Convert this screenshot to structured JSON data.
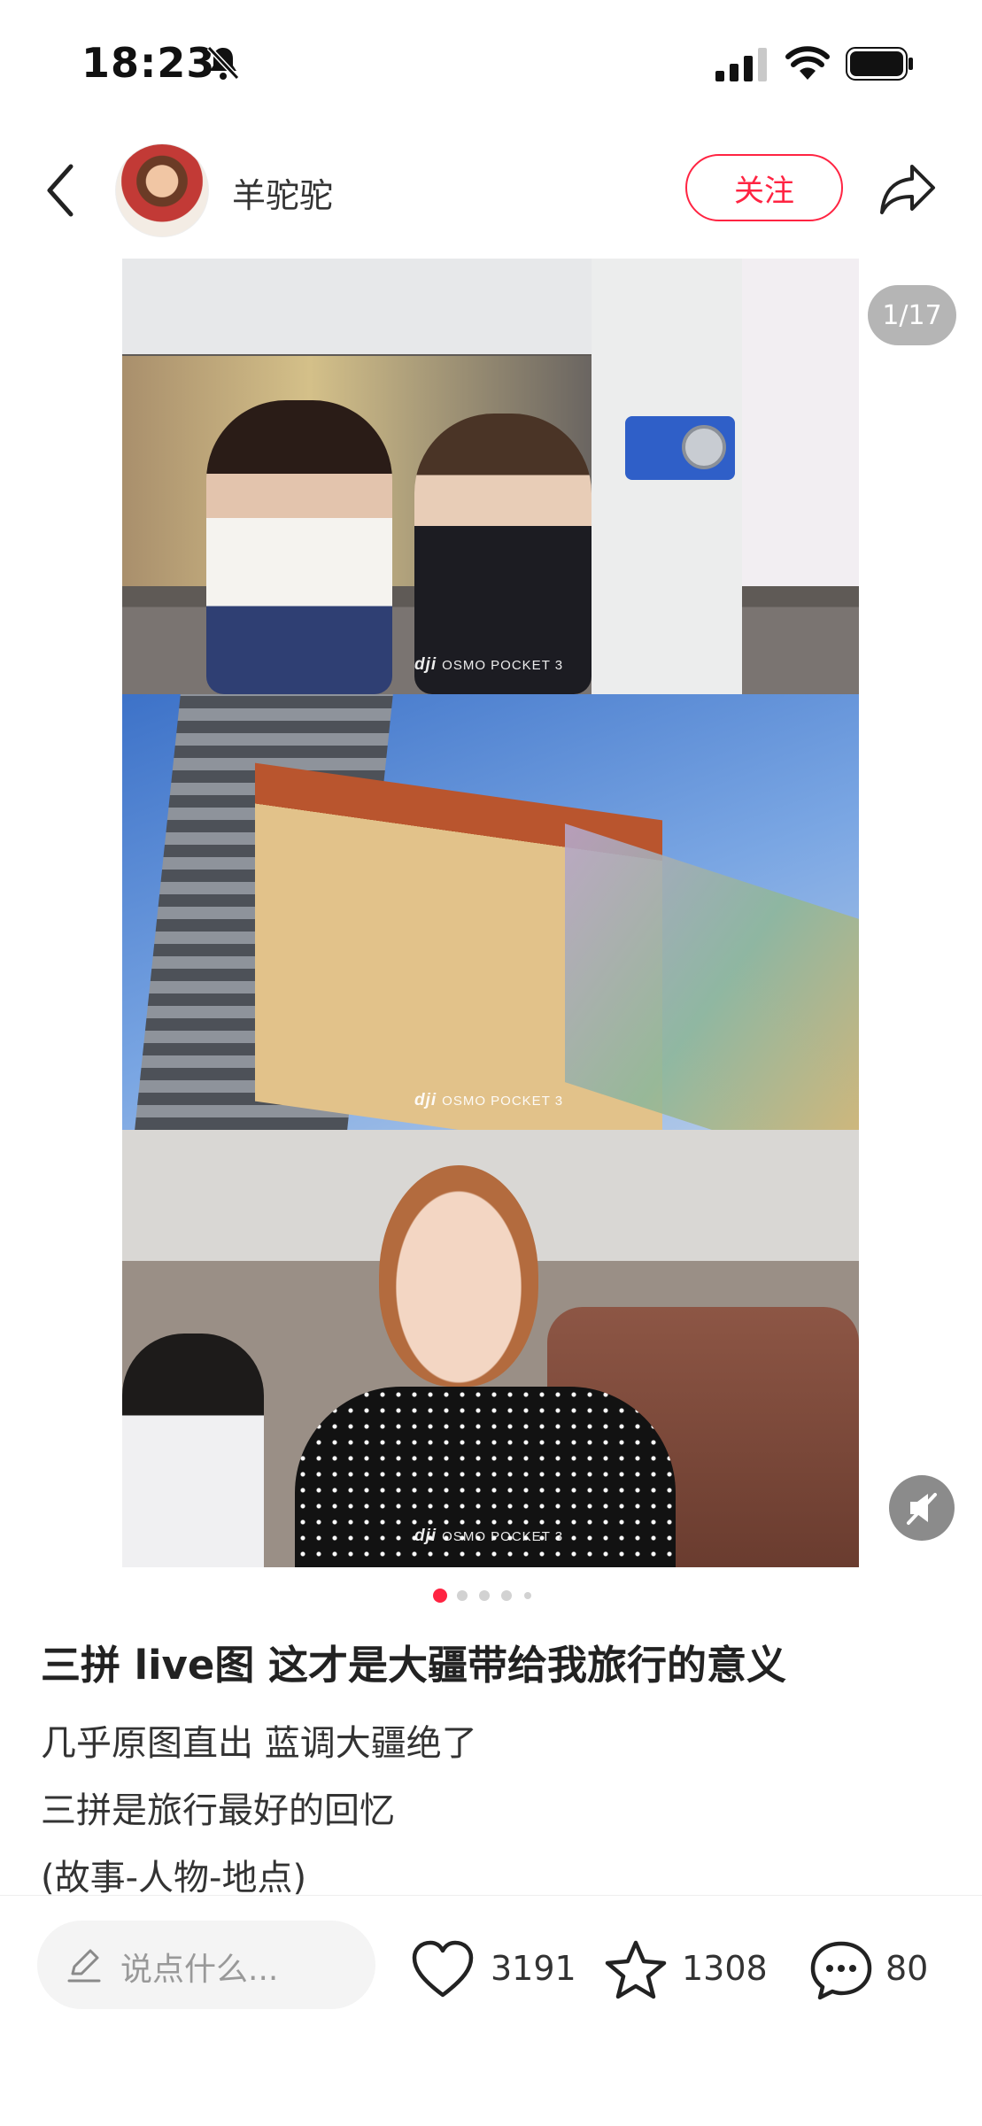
{
  "status_bar": {
    "time": "18:23",
    "icons": [
      "bell-slash-icon",
      "signal-icon",
      "wifi-icon",
      "battery-icon"
    ]
  },
  "header": {
    "back_icon": "chevron-left-icon",
    "author_name": "羊驼驼",
    "follow_label": "关注",
    "share_icon": "share-arrow-icon",
    "accent_color": "#ff2442"
  },
  "media": {
    "page_counter": "1/17",
    "watermark_brand": "dji",
    "watermark_product": "OSMO POCKET 3",
    "mute_icon": "speaker-mute-icon",
    "current_page": 1,
    "visible_dot_count": 5
  },
  "note": {
    "title": "三拼 live图 这才是大疆带给我旅行的意义",
    "lines": [
      "几乎原图直出 蓝调大疆绝了",
      "三拼是旅行最好的回忆",
      "(故事-人物-地点)"
    ]
  },
  "bottom_bar": {
    "comment_placeholder": "说点什么...",
    "likes": "3191",
    "collects": "1308",
    "comments": "80",
    "icons": [
      "pencil-icon",
      "heart-icon",
      "star-icon",
      "comment-bubble-icon"
    ]
  }
}
